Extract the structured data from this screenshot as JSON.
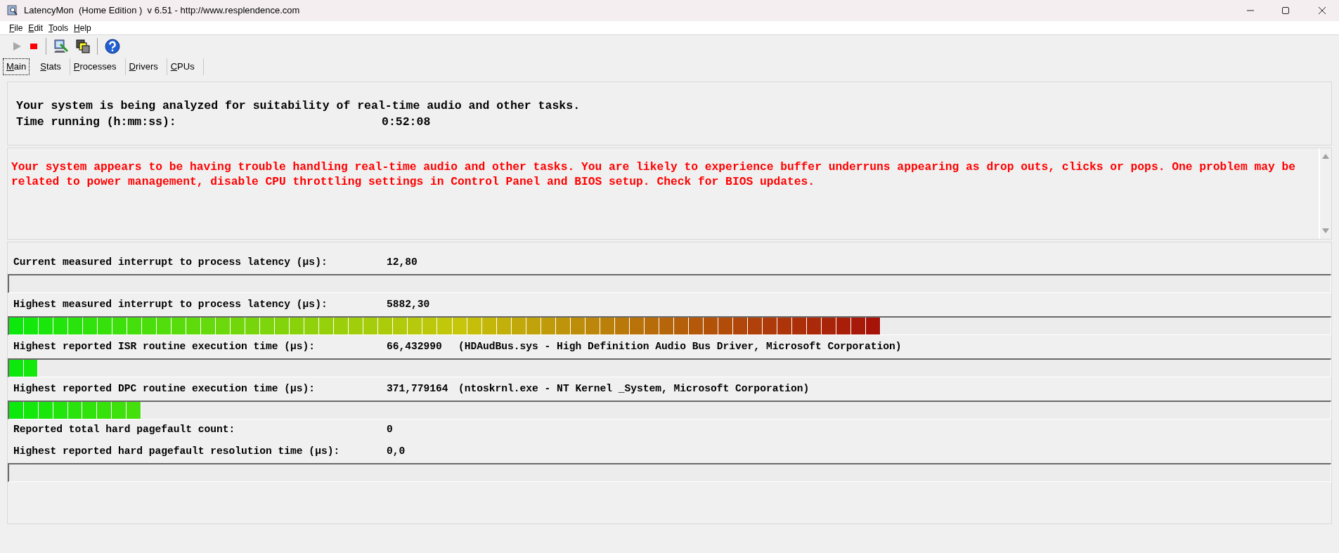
{
  "window": {
    "title": "LatencyMon  (Home Edition )  v 6.51 - http://www.resplendence.com"
  },
  "menu": [
    "File",
    "Edit",
    "Tools",
    "Help"
  ],
  "toolbar": [
    {
      "kind": "play",
      "disabled": true
    },
    {
      "kind": "stop",
      "disabled": false
    },
    {
      "kind": "separator"
    },
    {
      "kind": "report",
      "disabled": false
    },
    {
      "kind": "windows",
      "disabled": false
    },
    {
      "kind": "separator"
    },
    {
      "kind": "help",
      "disabled": false
    }
  ],
  "tabs": [
    {
      "label": "Main",
      "selected": true
    },
    {
      "label": "Stats",
      "selected": false
    },
    {
      "label": "Processes",
      "selected": false
    },
    {
      "label": "Drivers",
      "selected": false
    },
    {
      "label": "CPUs",
      "selected": false
    }
  ],
  "status": {
    "summary": "Your system is being analyzed for suitability of real-time audio and other tasks.",
    "time_label": "Time running (h:mm:ss):",
    "time_value": "0:52:08"
  },
  "verdict": {
    "message": "Your system appears to be having trouble handling real-time audio and other tasks. You are likely to experience buffer underruns appearing as drop outs, clicks or pops. One problem may be related to power management, disable CPU throttling settings in Control Panel and BIOS setup. Check for BIOS updates."
  },
  "metrics": [
    {
      "label": "Current measured interrupt to process latency (µs):",
      "value": "12,80",
      "kind": "meter",
      "level": 0
    },
    {
      "label": "Highest measured interrupt to process latency (µs):",
      "value": "5882,30",
      "kind": "meter",
      "level": 0.66
    },
    {
      "label": "Highest reported ISR routine execution time (µs):",
      "value": "66,432990",
      "detail": "(HDAudBus.sys - High Definition Audio Bus Driver, Microsoft Corporation)",
      "kind": "meter",
      "level": 0.022
    },
    {
      "label": "Highest reported DPC routine execution time (µs):",
      "value": "371,779164",
      "detail": "(ntoskrnl.exe - NT Kernel _System, Microsoft Corporation)",
      "kind": "meter",
      "level": 0.1
    },
    {
      "label": "Reported total hard pagefault count:",
      "value": "0",
      "kind": "plain"
    },
    {
      "label": "Highest reported hard pagefault resolution time (µs):",
      "value": "0,0",
      "kind": "meter",
      "level": 0
    }
  ]
}
